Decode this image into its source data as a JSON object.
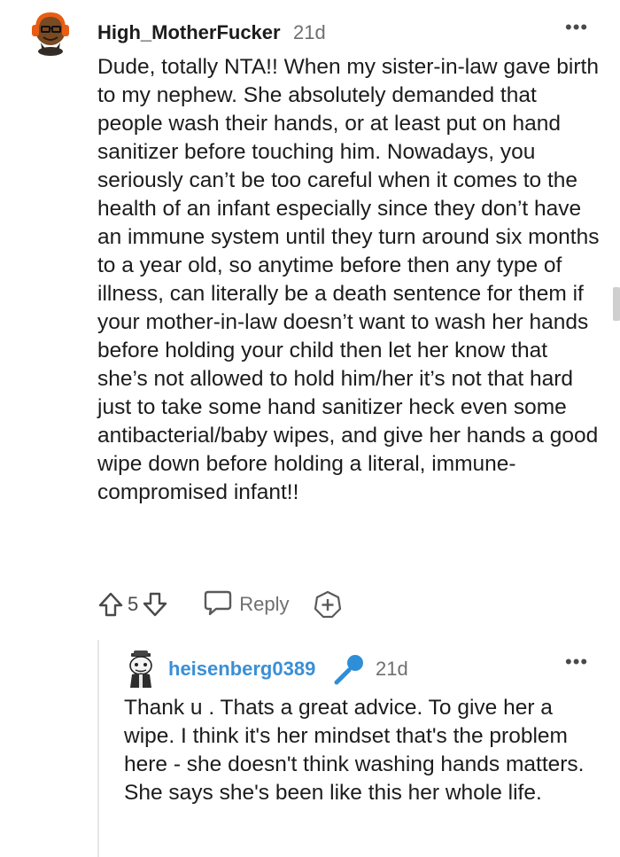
{
  "comment": {
    "username": "High_MotherFucker",
    "age": "21d",
    "more": "•••",
    "body": "Dude, totally NTA!! When my sister-in-law gave birth to my nephew. She absolutely demanded that people wash their hands, or at least put on hand sanitizer before touching him. Nowadays, you seriously can’t be too careful when it comes to the health of an infant especially since they don’t have an immune system until they turn around six months to a year old, so anytime before then any type of illness, can literally be a death sentence for them if your mother-in-law doesn’t want to wash her hands before holding your child then let her know that she’s not allowed to hold him/her it’s not that hard just to take some hand sanitizer heck even some antibacterial/baby wipes, and give her hands a good wipe down before holding a literal, immune-compromised infant!!",
    "score": "5",
    "reply_label": "Reply"
  },
  "reply": {
    "username": "heisenberg0389",
    "age": "21d",
    "more": "•••",
    "body": "Thank u . Thats a great advice. To give her a wipe. I think it's her mindset that's the problem here - she doesn't think washing hands matters. She says she's been like this her whole life."
  },
  "colors": {
    "username_reply": "#3a8fd6",
    "mic_badge": "#2f8ed8",
    "meta_gray": "#6f6f6f"
  },
  "icons": {
    "avatar1": "avatar-orange-headphones",
    "avatar2": "avatar-snoo-heisenberg",
    "mic": "microphone-icon",
    "upvote": "upvote-arrow-icon",
    "downvote": "downvote-arrow-icon",
    "reply": "speech-bubble-icon",
    "award": "award-plus-icon"
  }
}
